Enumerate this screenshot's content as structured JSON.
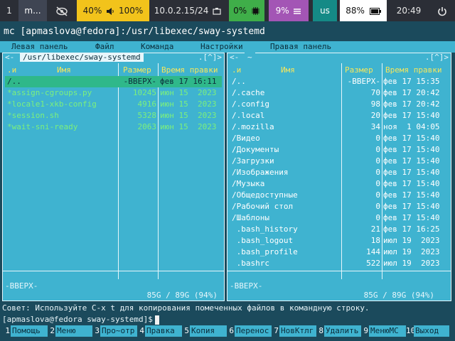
{
  "bar": {
    "workspaces": [
      {
        "label": "1",
        "active": false
      },
      {
        "label": "m...",
        "active": true
      }
    ],
    "privacy_icon": "eye-slash-icon",
    "brightness": "40%",
    "volume": "100%",
    "volume_icon": "speaker-icon",
    "ip": "10.0.2.15/24",
    "network_icon": "ethernet-icon",
    "cpu": "0%",
    "cpu_icon": "chip-icon",
    "memory": "9%",
    "memory_icon": "memory-icon",
    "layout": "us",
    "battery": "88%",
    "battery_icon": "battery-icon",
    "time": "20:49",
    "power_icon": "power-icon",
    "colors": {
      "bg": "#2b2e36",
      "yellow": "#f2c31b",
      "green": "#3fae49",
      "purple": "#a355b5",
      "teal": "#158a86",
      "white": "#ffffff"
    }
  },
  "title": "mc [apmaslova@fedora]:/usr/libexec/sway-systemd",
  "menu": [
    "Левая панель",
    "Файл",
    "Команда",
    "Настройки",
    "Правая панель"
  ],
  "left": {
    "path": "/usr/libexec/sway-systemd",
    "corner": ".[^]>",
    "corner_left": "<-",
    "cols": {
      "n": ".и",
      "name": "Имя",
      "size": "Размер",
      "time": "Время правки"
    },
    "rows": [
      {
        "name": "/..",
        "size": "-ВВЕРХ-",
        "time": "фев 17 16:11",
        "selected": true
      },
      {
        "name": "*assign-cgroups.py",
        "size": "10245",
        "time": "июн 15  2023"
      },
      {
        "name": "*locale1-xkb-config",
        "size": "4916",
        "time": "июн 15  2023"
      },
      {
        "name": "*session.sh",
        "size": "5328",
        "time": "июн 15  2023"
      },
      {
        "name": "*wait-sni-ready",
        "size": "2063",
        "time": "июн 15  2023"
      }
    ],
    "mini": "-ВВЕРХ-",
    "usage": "85G / 89G (94%)"
  },
  "right": {
    "path": "~",
    "corner": ".[^]>",
    "corner_left": "<-",
    "cols": {
      "n": ".и",
      "name": "Имя",
      "size": "Размер",
      "time": "Время правки"
    },
    "rows": [
      {
        "name": "/..",
        "size": "-ВВЕРХ-",
        "time": "фев 17 15:35"
      },
      {
        "name": "/.cache",
        "size": "70",
        "time": "фев 17 20:42"
      },
      {
        "name": "/.config",
        "size": "98",
        "time": "фев 17 20:42"
      },
      {
        "name": "/.local",
        "size": "20",
        "time": "фев 17 15:40"
      },
      {
        "name": "/.mozilla",
        "size": "34",
        "time": "ноя  1 04:05"
      },
      {
        "name": "/Видео",
        "size": "0",
        "time": "фев 17 15:40"
      },
      {
        "name": "/Документы",
        "size": "0",
        "time": "фев 17 15:40"
      },
      {
        "name": "/Загрузки",
        "size": "0",
        "time": "фев 17 15:40"
      },
      {
        "name": "/Изображения",
        "size": "0",
        "time": "фев 17 15:40"
      },
      {
        "name": "/Музыка",
        "size": "0",
        "time": "фев 17 15:40"
      },
      {
        "name": "/Общедоступные",
        "size": "0",
        "time": "фев 17 15:40"
      },
      {
        "name": "/Рабочий стол",
        "size": "0",
        "time": "фев 17 15:40"
      },
      {
        "name": "/Шаблоны",
        "size": "0",
        "time": "фев 17 15:40"
      },
      {
        "name": " .bash_history",
        "size": "21",
        "time": "фев 17 16:25"
      },
      {
        "name": " .bash_logout",
        "size": "18",
        "time": "июл 19  2023"
      },
      {
        "name": " .bash_profile",
        "size": "144",
        "time": "июл 19  2023"
      },
      {
        "name": " .bashrc",
        "size": "522",
        "time": "июл 19  2023"
      }
    ],
    "mini": "-ВВЕРХ-",
    "usage": "85G / 89G (94%)"
  },
  "hint": "Совет: Используйте C-x t для копирования помеченных файлов в командную строку.",
  "prompt": "[apmaslova@fedora sway-systemd]$",
  "fkeys": [
    {
      "n": "1",
      "label": "Помощь"
    },
    {
      "n": "2",
      "label": "Меню"
    },
    {
      "n": "3",
      "label": "Про~отр"
    },
    {
      "n": "4",
      "label": "Правка"
    },
    {
      "n": "5",
      "label": "Копия"
    },
    {
      "n": "6",
      "label": "Перенос"
    },
    {
      "n": "7",
      "label": "НовКтлг"
    },
    {
      "n": "8",
      "label": "Удалить"
    },
    {
      "n": "9",
      "label": "МенюMC"
    },
    {
      "n": "10",
      "label": "Выход"
    }
  ],
  "colors": {
    "panel": "#3fb3d0",
    "dir": "#ffffff",
    "exec": "#7cf07c",
    "header": "#f5e65c",
    "selected": "#2fb88a"
  }
}
